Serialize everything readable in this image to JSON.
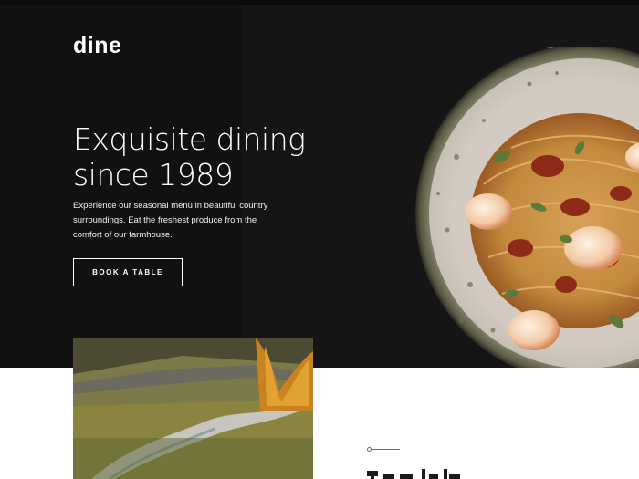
{
  "brand": {
    "logo_text": "dine"
  },
  "hero": {
    "headline_line1": "Exquisite dining",
    "headline_line2": "since 1989",
    "intro": "Experience our seasonal menu in beautiful country surroundings. Eat the freshest produce from the comfort of our farmhouse.",
    "cta_label": "BOOK A TABLE"
  },
  "colors": {
    "hero_background": "#151416",
    "hero_left_panel": "#111012",
    "text_light": "#ffffff",
    "page_background": "#ffffff"
  }
}
